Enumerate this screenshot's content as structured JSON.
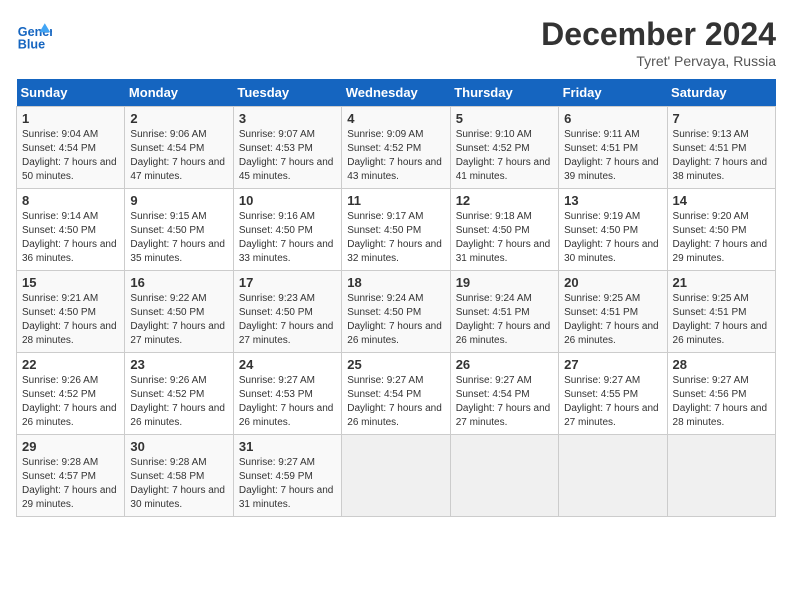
{
  "header": {
    "logo_line1": "General",
    "logo_line2": "Blue",
    "month": "December 2024",
    "location": "Tyret' Pervaya, Russia"
  },
  "days_of_week": [
    "Sunday",
    "Monday",
    "Tuesday",
    "Wednesday",
    "Thursday",
    "Friday",
    "Saturday"
  ],
  "weeks": [
    [
      {
        "day": "1",
        "sunrise": "Sunrise: 9:04 AM",
        "sunset": "Sunset: 4:54 PM",
        "daylight": "Daylight: 7 hours and 50 minutes."
      },
      {
        "day": "2",
        "sunrise": "Sunrise: 9:06 AM",
        "sunset": "Sunset: 4:54 PM",
        "daylight": "Daylight: 7 hours and 47 minutes."
      },
      {
        "day": "3",
        "sunrise": "Sunrise: 9:07 AM",
        "sunset": "Sunset: 4:53 PM",
        "daylight": "Daylight: 7 hours and 45 minutes."
      },
      {
        "day": "4",
        "sunrise": "Sunrise: 9:09 AM",
        "sunset": "Sunset: 4:52 PM",
        "daylight": "Daylight: 7 hours and 43 minutes."
      },
      {
        "day": "5",
        "sunrise": "Sunrise: 9:10 AM",
        "sunset": "Sunset: 4:52 PM",
        "daylight": "Daylight: 7 hours and 41 minutes."
      },
      {
        "day": "6",
        "sunrise": "Sunrise: 9:11 AM",
        "sunset": "Sunset: 4:51 PM",
        "daylight": "Daylight: 7 hours and 39 minutes."
      },
      {
        "day": "7",
        "sunrise": "Sunrise: 9:13 AM",
        "sunset": "Sunset: 4:51 PM",
        "daylight": "Daylight: 7 hours and 38 minutes."
      }
    ],
    [
      {
        "day": "8",
        "sunrise": "Sunrise: 9:14 AM",
        "sunset": "Sunset: 4:50 PM",
        "daylight": "Daylight: 7 hours and 36 minutes."
      },
      {
        "day": "9",
        "sunrise": "Sunrise: 9:15 AM",
        "sunset": "Sunset: 4:50 PM",
        "daylight": "Daylight: 7 hours and 35 minutes."
      },
      {
        "day": "10",
        "sunrise": "Sunrise: 9:16 AM",
        "sunset": "Sunset: 4:50 PM",
        "daylight": "Daylight: 7 hours and 33 minutes."
      },
      {
        "day": "11",
        "sunrise": "Sunrise: 9:17 AM",
        "sunset": "Sunset: 4:50 PM",
        "daylight": "Daylight: 7 hours and 32 minutes."
      },
      {
        "day": "12",
        "sunrise": "Sunrise: 9:18 AM",
        "sunset": "Sunset: 4:50 PM",
        "daylight": "Daylight: 7 hours and 31 minutes."
      },
      {
        "day": "13",
        "sunrise": "Sunrise: 9:19 AM",
        "sunset": "Sunset: 4:50 PM",
        "daylight": "Daylight: 7 hours and 30 minutes."
      },
      {
        "day": "14",
        "sunrise": "Sunrise: 9:20 AM",
        "sunset": "Sunset: 4:50 PM",
        "daylight": "Daylight: 7 hours and 29 minutes."
      }
    ],
    [
      {
        "day": "15",
        "sunrise": "Sunrise: 9:21 AM",
        "sunset": "Sunset: 4:50 PM",
        "daylight": "Daylight: 7 hours and 28 minutes."
      },
      {
        "day": "16",
        "sunrise": "Sunrise: 9:22 AM",
        "sunset": "Sunset: 4:50 PM",
        "daylight": "Daylight: 7 hours and 27 minutes."
      },
      {
        "day": "17",
        "sunrise": "Sunrise: 9:23 AM",
        "sunset": "Sunset: 4:50 PM",
        "daylight": "Daylight: 7 hours and 27 minutes."
      },
      {
        "day": "18",
        "sunrise": "Sunrise: 9:24 AM",
        "sunset": "Sunset: 4:50 PM",
        "daylight": "Daylight: 7 hours and 26 minutes."
      },
      {
        "day": "19",
        "sunrise": "Sunrise: 9:24 AM",
        "sunset": "Sunset: 4:51 PM",
        "daylight": "Daylight: 7 hours and 26 minutes."
      },
      {
        "day": "20",
        "sunrise": "Sunrise: 9:25 AM",
        "sunset": "Sunset: 4:51 PM",
        "daylight": "Daylight: 7 hours and 26 minutes."
      },
      {
        "day": "21",
        "sunrise": "Sunrise: 9:25 AM",
        "sunset": "Sunset: 4:51 PM",
        "daylight": "Daylight: 7 hours and 26 minutes."
      }
    ],
    [
      {
        "day": "22",
        "sunrise": "Sunrise: 9:26 AM",
        "sunset": "Sunset: 4:52 PM",
        "daylight": "Daylight: 7 hours and 26 minutes."
      },
      {
        "day": "23",
        "sunrise": "Sunrise: 9:26 AM",
        "sunset": "Sunset: 4:52 PM",
        "daylight": "Daylight: 7 hours and 26 minutes."
      },
      {
        "day": "24",
        "sunrise": "Sunrise: 9:27 AM",
        "sunset": "Sunset: 4:53 PM",
        "daylight": "Daylight: 7 hours and 26 minutes."
      },
      {
        "day": "25",
        "sunrise": "Sunrise: 9:27 AM",
        "sunset": "Sunset: 4:54 PM",
        "daylight": "Daylight: 7 hours and 26 minutes."
      },
      {
        "day": "26",
        "sunrise": "Sunrise: 9:27 AM",
        "sunset": "Sunset: 4:54 PM",
        "daylight": "Daylight: 7 hours and 27 minutes."
      },
      {
        "day": "27",
        "sunrise": "Sunrise: 9:27 AM",
        "sunset": "Sunset: 4:55 PM",
        "daylight": "Daylight: 7 hours and 27 minutes."
      },
      {
        "day": "28",
        "sunrise": "Sunrise: 9:27 AM",
        "sunset": "Sunset: 4:56 PM",
        "daylight": "Daylight: 7 hours and 28 minutes."
      }
    ],
    [
      {
        "day": "29",
        "sunrise": "Sunrise: 9:28 AM",
        "sunset": "Sunset: 4:57 PM",
        "daylight": "Daylight: 7 hours and 29 minutes."
      },
      {
        "day": "30",
        "sunrise": "Sunrise: 9:28 AM",
        "sunset": "Sunset: 4:58 PM",
        "daylight": "Daylight: 7 hours and 30 minutes."
      },
      {
        "day": "31",
        "sunrise": "Sunrise: 9:27 AM",
        "sunset": "Sunset: 4:59 PM",
        "daylight": "Daylight: 7 hours and 31 minutes."
      },
      null,
      null,
      null,
      null
    ]
  ]
}
